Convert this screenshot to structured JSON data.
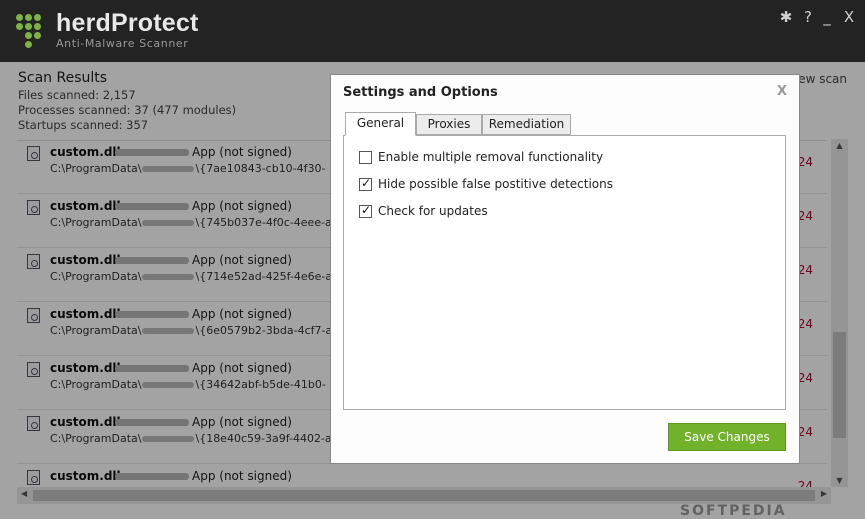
{
  "app": {
    "name": "herdProtect",
    "tagline": "Anti-Malware Scanner",
    "accent_color": "#72b22b",
    "window_controls": [
      {
        "icon": "tools-icon",
        "glyph": "✱"
      },
      {
        "icon": "help-icon",
        "glyph": "?"
      },
      {
        "icon": "minimize-icon",
        "glyph": "_"
      },
      {
        "icon": "close-icon",
        "glyph": "X"
      }
    ]
  },
  "scan": {
    "title": "Scan Results",
    "files": "Files scanned:  2,157",
    "processes": "Processes scanned:  37 (477 modules)",
    "startups": "Startups scanned:  357",
    "new_scan": "New scan"
  },
  "results": [
    {
      "file": "custom.dll",
      "app": "App (not signed)",
      "path_prefix": "C:\\ProgramData\\",
      "path_suffix": "\\{7ae10843-cb10-4f30-",
      "count": "24"
    },
    {
      "file": "custom.dll",
      "app": "App (not signed)",
      "path_prefix": "C:\\ProgramData\\",
      "path_suffix": "\\{745b037e-4f0c-4eee-a",
      "count": "24"
    },
    {
      "file": "custom.dll",
      "app": "App (not signed)",
      "path_prefix": "C:\\ProgramData\\",
      "path_suffix": "\\{714e52ad-425f-4e6e-a",
      "count": "24"
    },
    {
      "file": "custom.dll",
      "app": "App (not signed)",
      "path_prefix": "C:\\ProgramData\\",
      "path_suffix": "\\{6e0579b2-3bda-4cf7-a",
      "count": "24"
    },
    {
      "file": "custom.dll",
      "app": "App (not signed)",
      "path_prefix": "C:\\ProgramData\\",
      "path_suffix": "\\{34642abf-b5de-41b0-",
      "count": "24"
    },
    {
      "file": "custom.dll",
      "app": "App (not signed)",
      "path_prefix": "C:\\ProgramData\\",
      "path_suffix": "\\{18e40c59-3a9f-4402-a",
      "count": "24"
    },
    {
      "file": "custom.dll",
      "app": "App (not signed)",
      "path_prefix": "",
      "path_suffix": "",
      "count": "24"
    }
  ],
  "watermark": "SOFTPEDIA",
  "dialog": {
    "title": "Settings and Options",
    "close": "X",
    "tabs": [
      "General",
      "Proxies",
      "Remediation"
    ],
    "active_tab": "General",
    "options": [
      {
        "label": "Enable multiple removal functionality",
        "checked": false
      },
      {
        "label": "Hide possible false postitive detections",
        "checked": true
      },
      {
        "label": "Check for updates",
        "checked": true
      }
    ],
    "save_label": "Save Changes"
  }
}
